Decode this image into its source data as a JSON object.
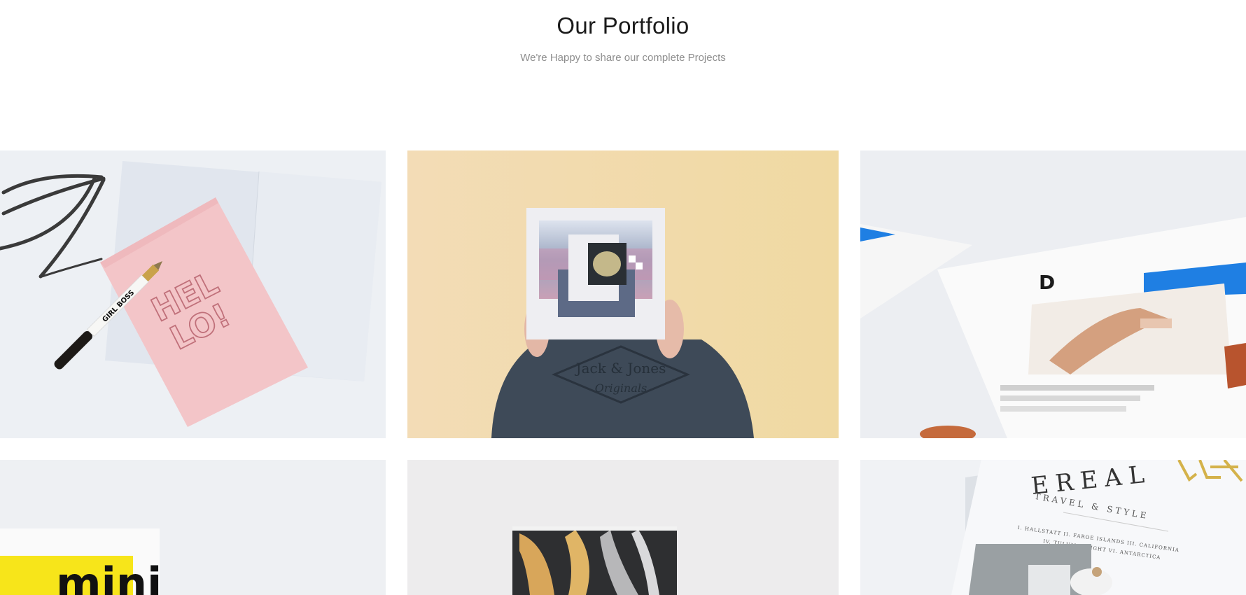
{
  "portfolio": {
    "title": "Our Portfolio",
    "subtitle": "We're Happy to share our complete Projects"
  },
  "items": [
    {
      "image": "pink-hello-notebook-with-glasses-and-pen",
      "notebook_text_line1": "HEL",
      "notebook_text_line2": "LO!",
      "pen_text": "GIRL BOSS"
    },
    {
      "image": "person-holding-art-print-in-front-of-face",
      "sweater_text_1": "Jack & Jones",
      "sweater_text_2": "Originals"
    },
    {
      "image": "blurred-magazine-page-with-blue-tape",
      "page_letter": "D"
    },
    {
      "image": "yellow-mini-magazine-cover",
      "cover_text": "mini"
    },
    {
      "image": "abstract-paint-canvas-leaning-on-wall"
    },
    {
      "image": "travel-style-magazine-on-clipboard",
      "masthead": "EREAL",
      "tagline": "TRAVEL & STYLE",
      "contents_1": "I. HALLSTATT  II. FAROE ISLANDS  III. CALIFORNIA",
      "contents_2": "IV. TULUM  V. LIGHT  VI. ANTARCTICA"
    }
  ],
  "colors": {
    "title": "#1a1a1a",
    "subtitle": "#8e8e8e",
    "notebook_pink": "#f3c5c8",
    "wall_yellow": "#f1d9a8",
    "tape_blue": "#1f7fe3",
    "mini_yellow": "#f7e51a"
  }
}
